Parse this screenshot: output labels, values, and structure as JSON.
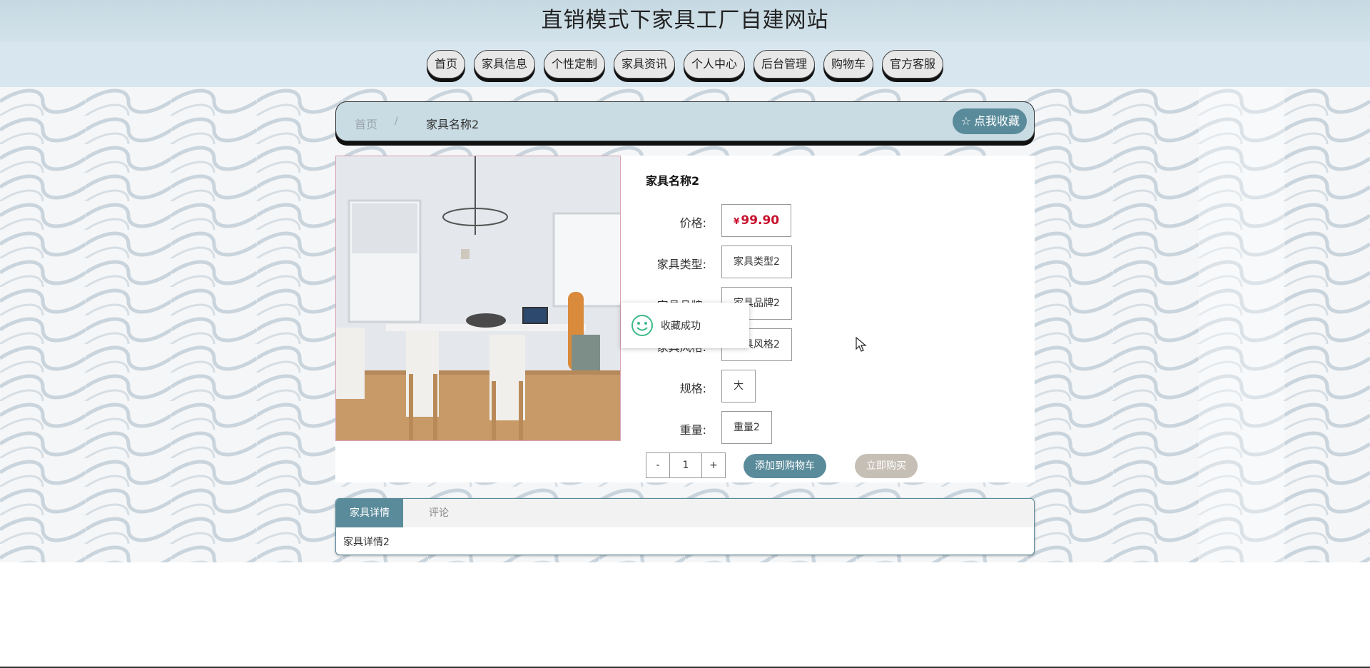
{
  "site": {
    "title": "直销模式下家具工厂自建网站"
  },
  "nav": {
    "items": [
      "首页",
      "家具信息",
      "个性定制",
      "家具资讯",
      "个人中心",
      "后台管理",
      "购物车",
      "官方客服"
    ]
  },
  "breadcrumb": {
    "home": "首页",
    "separator": "/",
    "current": "家具名称2"
  },
  "favorite_button": {
    "label": "点我收藏",
    "icon": "star-icon"
  },
  "product": {
    "name": "家具名称2",
    "fields": [
      {
        "label": "价格:",
        "value": "99.90",
        "currency": "¥"
      },
      {
        "label": "家具类型:",
        "value": "家具类型2"
      },
      {
        "label": "家具品牌:",
        "value": "家具品牌2"
      },
      {
        "label": "家具风格:",
        "value": "家具风格2"
      },
      {
        "label": "规格:",
        "value": "大"
      },
      {
        "label": "重量:",
        "value": "重量2"
      }
    ],
    "quantity": {
      "minus": "-",
      "value": "1",
      "plus": "+"
    },
    "add_to_cart": "添加到购物车",
    "buy_now": "立即购买"
  },
  "toast": {
    "message": "收藏成功",
    "icon": "smile-icon"
  },
  "tabs": {
    "items": [
      "家具详情",
      "评论"
    ],
    "active": "家具详情",
    "content": "家具详情2"
  },
  "colors": {
    "accent": "#5a8b9b",
    "price": "#c8102e",
    "header_bg": "#c6d9e2",
    "nav_bg": "#d8e6ef",
    "buy_now_bg": "#c6bfb6"
  }
}
